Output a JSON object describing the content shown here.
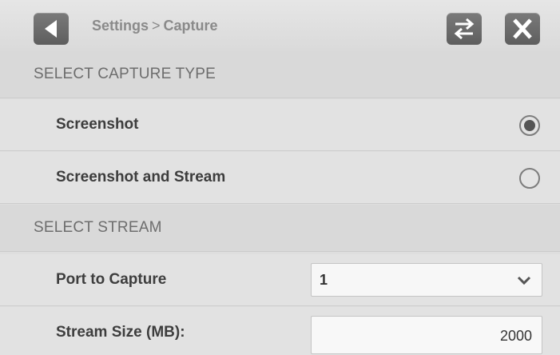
{
  "header": {
    "breadcrumb_parent": "Settings",
    "breadcrumb_separator": ">",
    "breadcrumb_current": "Capture",
    "back_icon": "back-icon",
    "swap_icon": "swap-icon",
    "close_icon": "close-icon"
  },
  "capture_type": {
    "section_title": "SELECT CAPTURE TYPE",
    "options": [
      {
        "label": "Screenshot",
        "selected": true
      },
      {
        "label": "Screenshot and Stream",
        "selected": false
      }
    ]
  },
  "stream": {
    "section_title": "SELECT STREAM",
    "port_label": "Port to Capture",
    "port_value": "1",
    "size_label": "Stream Size (MB):",
    "size_value": "2000"
  },
  "colors": {
    "icon_button": "#666666",
    "background": "#dedede"
  }
}
